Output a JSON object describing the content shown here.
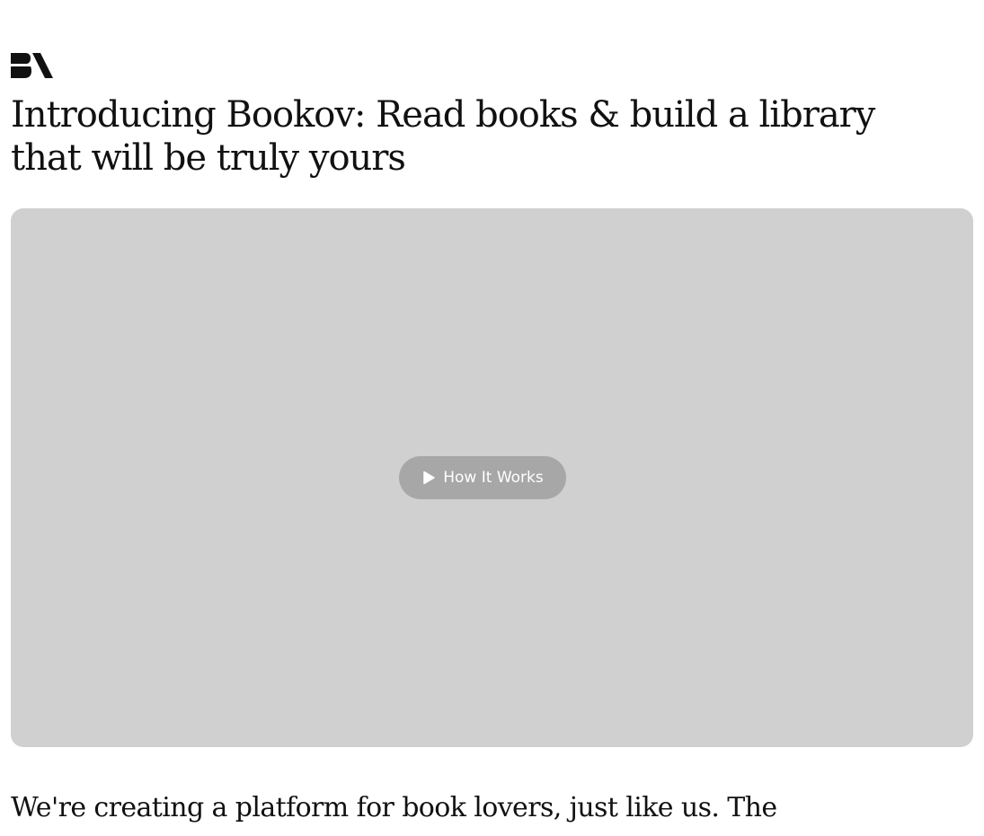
{
  "brand": {
    "logo_icon": "bookov-logo-icon"
  },
  "article": {
    "title": "Introducing Bookov: Read books & build a library that will be truly yours",
    "video": {
      "button_label": "How It Works",
      "button_icon": "play-icon"
    },
    "intro_text": "We're creating a platform for book lovers, just like us. The"
  },
  "colors": {
    "text": "#111111",
    "video_placeholder": "#d0d0d0",
    "play_pill": "#a7a7a7",
    "play_text": "#ffffff"
  }
}
